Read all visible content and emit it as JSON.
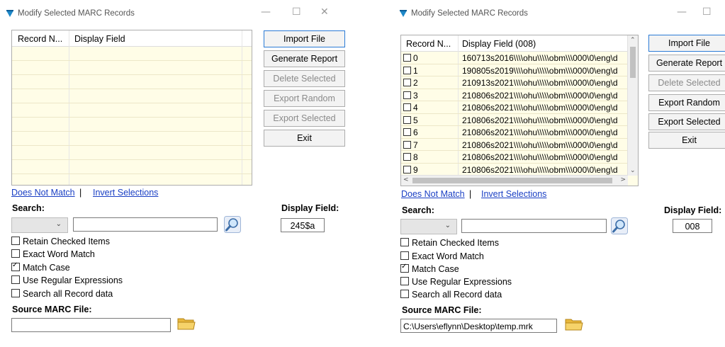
{
  "window_title": "Modify Selected MARC Records",
  "window_controls": {
    "minimize": "—",
    "maximize": "☐",
    "close": "✕"
  },
  "left": {
    "grid": {
      "col1": "Record N...",
      "col2": "Display Field"
    },
    "buttons": {
      "import": "Import File",
      "report": "Generate Report",
      "delete": "Delete Selected",
      "random": "Export Random",
      "selected": "Export Selected",
      "exit": "Exit"
    },
    "links": {
      "does_not_match": "Does Not Match",
      "separator": "|",
      "invert": "Invert Selections"
    },
    "search_label": "Search:",
    "display_field_label": "Display Field:",
    "display_field_value": "245$a",
    "search_value": "",
    "options": {
      "retain": "Retain Checked Items",
      "exact": "Exact Word Match",
      "match_case": "Match Case",
      "regex": "Use Regular Expressions",
      "search_all": "Search all Record data"
    },
    "source_label": "Source MARC File:",
    "source_value": ""
  },
  "right": {
    "grid": {
      "col1": "Record N...",
      "col2": "Display Field (008)",
      "rows": [
        {
          "num": "0",
          "field": "160713s2016\\\\\\\\ohu\\\\\\\\\\obm\\\\\\000\\0\\eng\\d"
        },
        {
          "num": "1",
          "field": "190805s2019\\\\\\\\ohu\\\\\\\\\\obm\\\\\\000\\0\\eng\\d"
        },
        {
          "num": "2",
          "field": "210913s2021\\\\\\\\ohu\\\\\\\\\\obm\\\\\\000\\0\\eng\\d"
        },
        {
          "num": "3",
          "field": "210806s2021\\\\\\\\ohu\\\\\\\\\\obm\\\\\\000\\0\\eng\\d"
        },
        {
          "num": "4",
          "field": "210806s2021\\\\\\\\ohu\\\\\\\\\\obm\\\\\\000\\0\\eng\\d"
        },
        {
          "num": "5",
          "field": "210806s2021\\\\\\\\ohu\\\\\\\\\\obm\\\\\\000\\0\\eng\\d"
        },
        {
          "num": "6",
          "field": "210806s2021\\\\\\\\ohu\\\\\\\\\\obm\\\\\\000\\0\\eng\\d"
        },
        {
          "num": "7",
          "field": "210806s2021\\\\\\\\ohu\\\\\\\\\\obm\\\\\\000\\0\\eng\\d"
        },
        {
          "num": "8",
          "field": "210806s2021\\\\\\\\ohu\\\\\\\\\\obm\\\\\\000\\0\\eng\\d"
        },
        {
          "num": "9",
          "field": "210806s2021\\\\\\\\ohu\\\\\\\\\\obm\\\\\\000\\0\\eng\\d"
        }
      ]
    },
    "buttons": {
      "import": "Import File",
      "report": "Generate Report",
      "delete": "Delete Selected",
      "random": "Export Random",
      "selected": "Export Selected",
      "exit": "Exit"
    },
    "links": {
      "does_not_match": "Does Not Match",
      "separator": "|",
      "invert": "Invert Selections"
    },
    "search_label": "Search:",
    "display_field_label": "Display Field:",
    "display_field_value": "008",
    "search_value": "",
    "options": {
      "retain": "Retain Checked Items",
      "exact": "Exact Word Match",
      "match_case": "Match Case",
      "regex": "Use Regular Expressions",
      "search_all": "Search all Record data"
    },
    "source_label": "Source MARC File:",
    "source_value": "C:\\Users\\eflynn\\Desktop\\temp.mrk"
  },
  "checked": {
    "match_case": true,
    "retain": false,
    "exact": false,
    "regex": false,
    "search_all": false
  },
  "icons": {
    "app": "marc-app-icon",
    "search": "magnifier-icon",
    "folder": "folder-icon"
  },
  "colors": {
    "grid_bg": "#fffde7",
    "link": "#1a3fc4",
    "primary_border": "#2b7bd6"
  }
}
